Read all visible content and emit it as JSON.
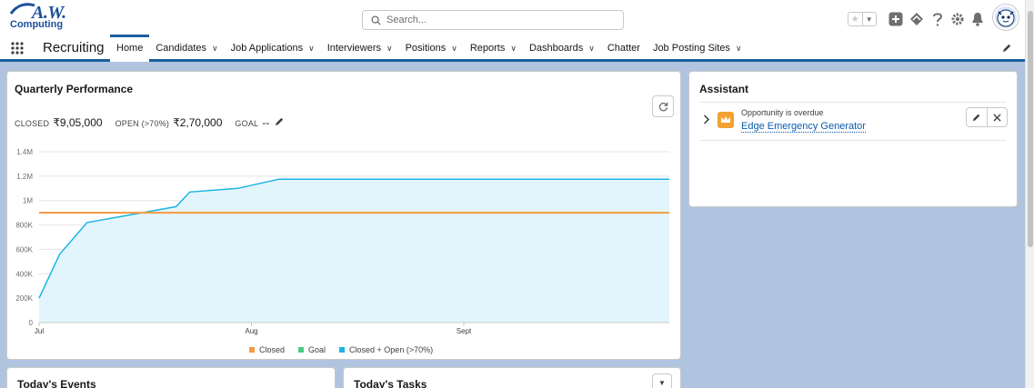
{
  "header": {
    "logo_text": "A.W.",
    "logo_sub": "Computing",
    "search_placeholder": "Search..."
  },
  "nav": {
    "app_name": "Recruiting",
    "items": [
      {
        "label": "Home",
        "chevron": false,
        "active": true
      },
      {
        "label": "Candidates",
        "chevron": true
      },
      {
        "label": "Job Applications",
        "chevron": true
      },
      {
        "label": "Interviewers",
        "chevron": true
      },
      {
        "label": "Positions",
        "chevron": true
      },
      {
        "label": "Reports",
        "chevron": true
      },
      {
        "label": "Dashboards",
        "chevron": true
      },
      {
        "label": "Chatter",
        "chevron": false
      },
      {
        "label": "Job Posting Sites",
        "chevron": true
      }
    ]
  },
  "performance": {
    "title": "Quarterly Performance",
    "closed_label": "CLOSED",
    "closed_value": "₹9,05,000",
    "open_label": "OPEN (>70%)",
    "open_value": "₹2,70,000",
    "goal_label": "GOAL",
    "goal_value": "--"
  },
  "chart_data": {
    "type": "line",
    "x_ticks": [
      "Jul",
      "Aug",
      "Sept"
    ],
    "y_ticks": [
      "0",
      "200K",
      "400K",
      "600K",
      "800K",
      "1M",
      "1.2M",
      "1.4M"
    ],
    "ylim": [
      0,
      1400000
    ],
    "xlim": [
      0,
      92
    ],
    "goal": 900000,
    "series": [
      {
        "name": "Closed + Open (>70%)",
        "color": "#1bb5e6",
        "fill": "#e3f5fc",
        "x": [
          0,
          3,
          7,
          14,
          20,
          22,
          29,
          35,
          92
        ],
        "y": [
          200000,
          560000,
          820000,
          890000,
          950000,
          1070000,
          1100000,
          1175000,
          1175000
        ]
      },
      {
        "name": "Goal",
        "color": "#f59a3e",
        "x": [
          0,
          92
        ],
        "y": [
          900000,
          900000
        ]
      }
    ],
    "legend": [
      {
        "name": "Closed",
        "color": "#f59a3e"
      },
      {
        "name": "Goal",
        "color": "#4bca81"
      },
      {
        "name": "Closed + Open (>70%)",
        "color": "#1bb5e6"
      }
    ]
  },
  "assistant": {
    "title": "Assistant",
    "item_subtitle": "Opportunity is overdue",
    "item_link": "Edge Emergency Generator"
  },
  "events": {
    "title": "Today's Events"
  },
  "tasks": {
    "title": "Today's Tasks"
  }
}
